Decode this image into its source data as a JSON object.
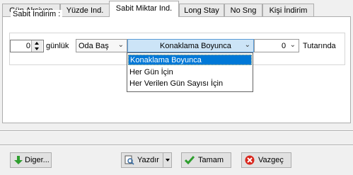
{
  "tabs": [
    {
      "label": "Gün Aksiyon"
    },
    {
      "label": "Yüzde Ind."
    },
    {
      "label": "Sabit Miktar Ind."
    },
    {
      "label": "Long Stay"
    },
    {
      "label": "No Sng"
    },
    {
      "label": "Kişi İndirim"
    }
  ],
  "active_tab_index": 2,
  "group": {
    "title": "Sabit İndirim :",
    "days_value": "0",
    "days_label": "günlük",
    "room_select": "Oda Baş",
    "period_select": "Konaklama Boyunca",
    "amount_select": "0",
    "amount_label": "Tutarında"
  },
  "dropdown": {
    "options": [
      "Konaklama Boyunca",
      "Her Gün İçin",
      "Her Verilen Gün Sayısı İçin"
    ],
    "selected_index": 0
  },
  "buttons": {
    "diger": "Diger...",
    "yazdir": "Yazdır",
    "tamam": "Tamam",
    "vazgec": "Vazgeç"
  },
  "colors": {
    "selection": "#0078d7",
    "combo_highlight": "#cce4f7"
  }
}
